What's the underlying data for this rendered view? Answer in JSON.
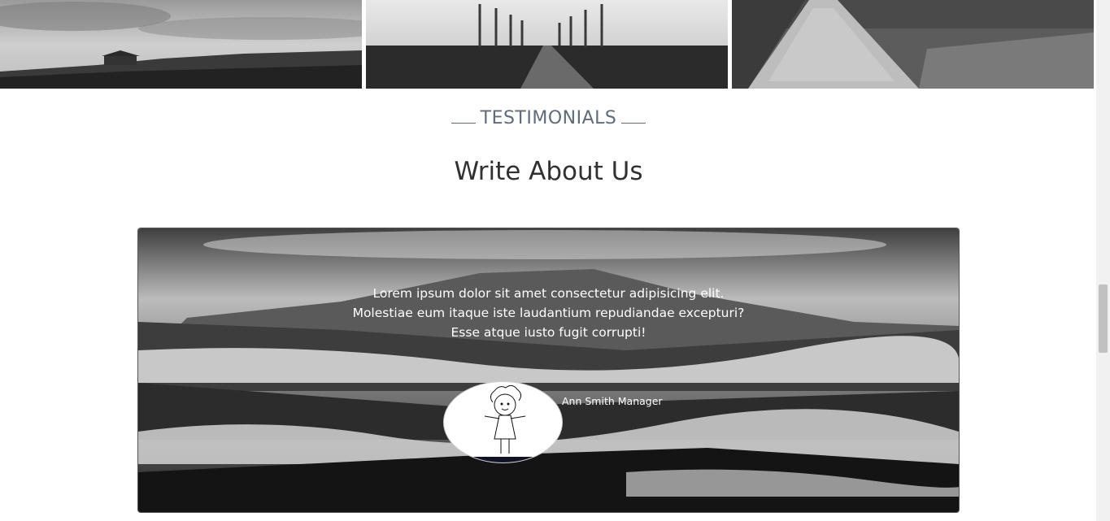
{
  "section": {
    "eyebrow": "TESTIMONIALS",
    "headline": "Write About Us"
  },
  "testimonial": {
    "quote": "Lorem ipsum dolor sit amet consectetur adipisicing elit. Molestiae eum itaque iste laudantium repudiandae excepturi? Esse atque iusto fugit corrupti!",
    "author": "Ann Smith Manager"
  },
  "gallery": {
    "tiles": [
      "landscape-barn-photo",
      "tree-lined-road-photo",
      "wet-path-field-photo"
    ]
  }
}
